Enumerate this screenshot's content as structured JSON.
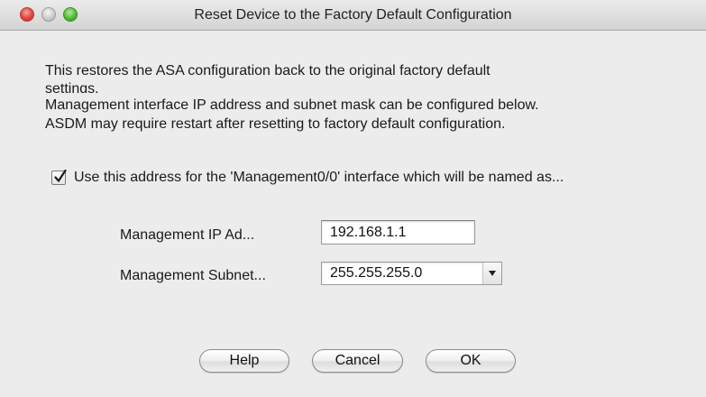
{
  "window": {
    "title": "Reset Device to the Factory Default Configuration"
  },
  "description": {
    "line1": "This restores the ASA configuration back to the original factory default",
    "line1_wrap": "settings.",
    "line2": "Management interface IP address and subnet mask can be configured below.",
    "line3": "ASDM may require restart after resetting to factory default configuration."
  },
  "option": {
    "checked": true,
    "label": "Use this address for the 'Management0/0' interface which will be named as..."
  },
  "fields": {
    "ip_label": "Management IP Ad...",
    "ip_value": "192.168.1.1",
    "subnet_label": "Management Subnet...",
    "subnet_value": "255.255.255.0"
  },
  "buttons": {
    "help": "Help",
    "cancel": "Cancel",
    "ok": "OK"
  },
  "icons": {
    "close": "close-traffic-light-icon",
    "minimize": "minimize-traffic-light-icon",
    "zoom": "zoom-traffic-light-icon",
    "checkmark": "checkmark-icon",
    "dropdown": "chevron-down-icon"
  },
  "colors": {
    "close": "#e0443e",
    "minimize": "#c9c9c9",
    "zoom": "#4fbb35",
    "window_bg": "#ececec"
  }
}
